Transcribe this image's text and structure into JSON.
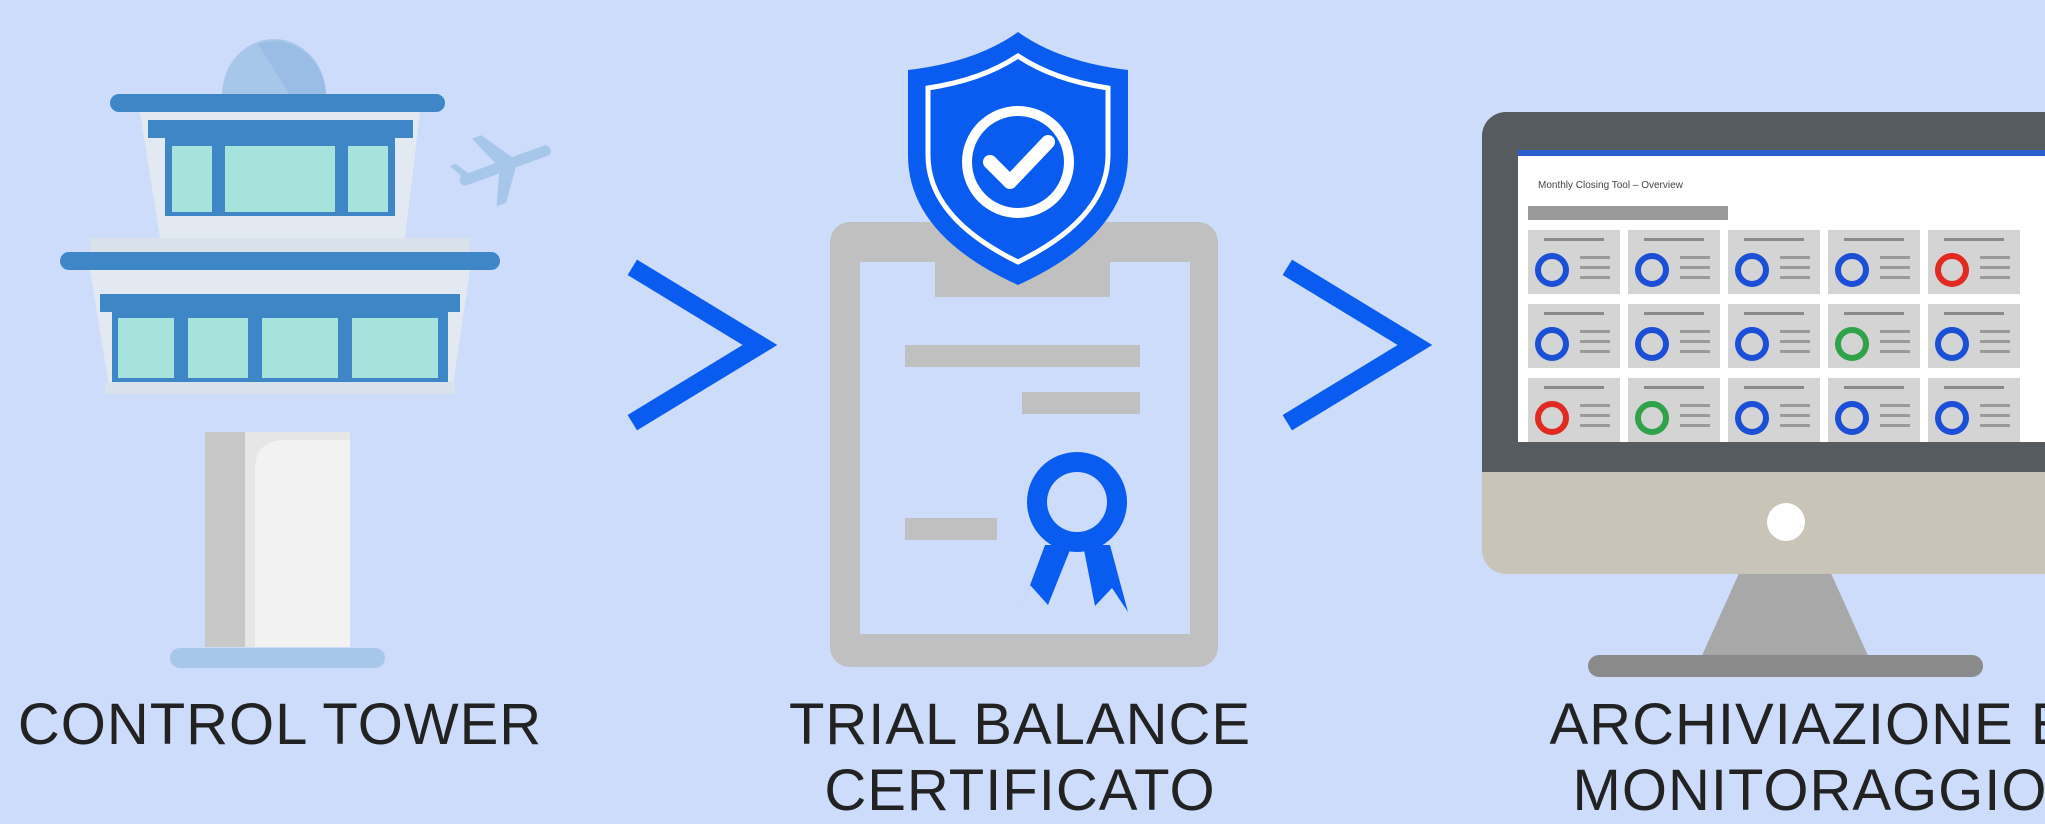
{
  "steps": [
    {
      "label": "CONTROL TOWER",
      "icon": "control-tower-icon"
    },
    {
      "label_line1": "TRIAL BALANCE",
      "label_line2": "CERTIFICATO",
      "icon": "certificate-clipboard-icon"
    },
    {
      "label_line1": "ARCHIVIAZIONE E",
      "label_line2": "MONITORAGGIO",
      "icon": "monitor-dashboard-icon"
    }
  ],
  "monitor_screen": {
    "title": "Monthly Closing Tool – Overview"
  },
  "colors": {
    "background": "#cddcfb",
    "accent_blue": "#0a5cf0",
    "gray": "#c0c0c0",
    "teal": "#a6e3dc",
    "tower_blue": "#3f86c6",
    "red": "#e02a22",
    "green": "#2fa24a"
  }
}
